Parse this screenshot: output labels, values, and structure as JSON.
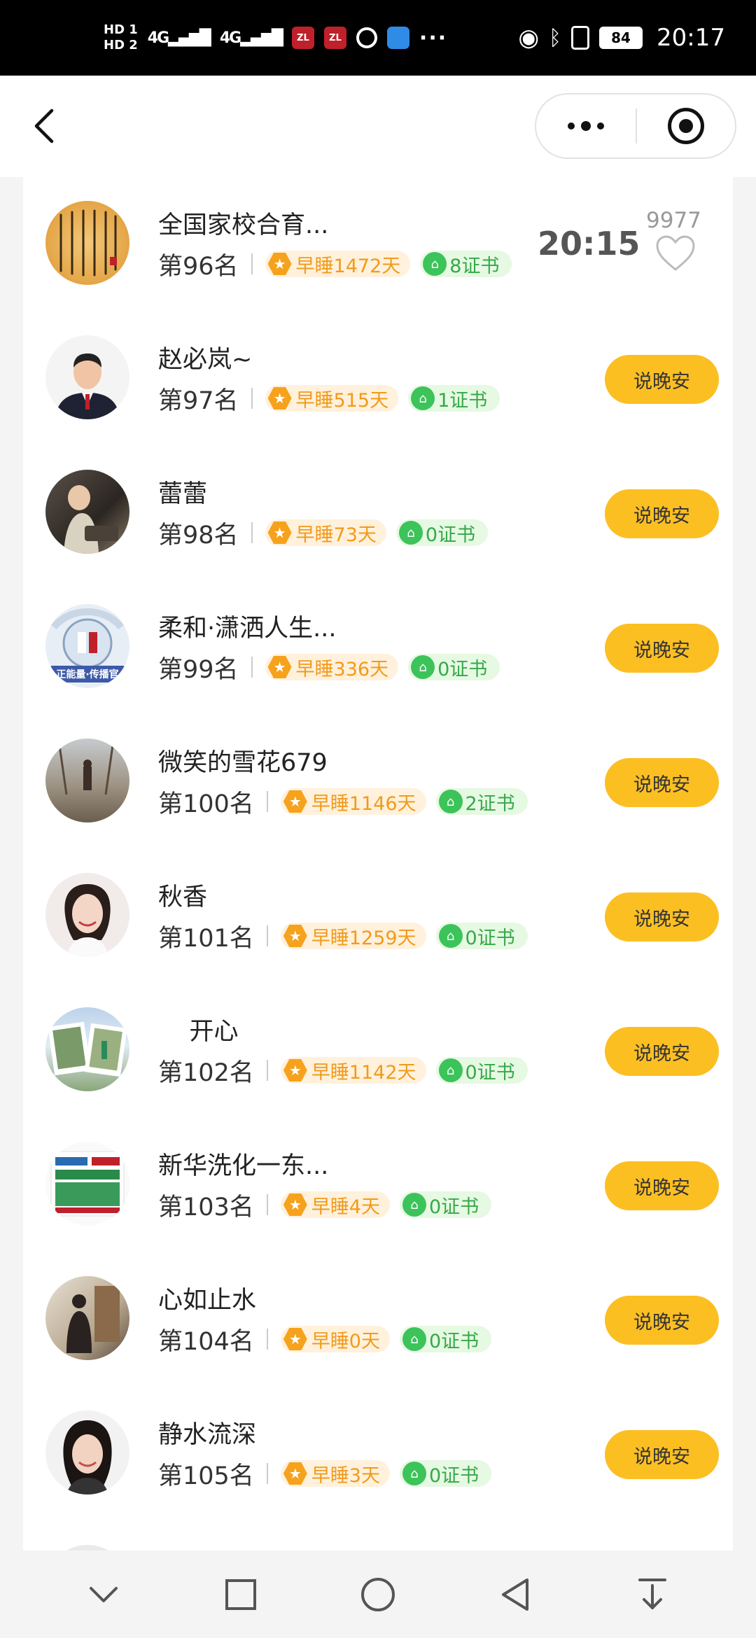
{
  "status_bar": {
    "hd1": "HD 1",
    "hd2": "HD 2",
    "signal1": "4G",
    "signal2": "4G",
    "app1": "ZL",
    "app2": "ZL",
    "more": "···",
    "battery": "84",
    "time": "20:17"
  },
  "nav": {
    "back_icon": "chevron-left-icon",
    "more_icon": "more-dots-icon",
    "close_icon": "target-circle-icon"
  },
  "first_row_extra": {
    "time": "20:15",
    "likes": "9977"
  },
  "rows": [
    {
      "name": "全国家校合育...",
      "rank": "第96名",
      "sleep": "早睡1472天",
      "cert": "8证书",
      "button": ""
    },
    {
      "name": "赵必岚~",
      "rank": "第97名",
      "sleep": "早睡515天",
      "cert": "1证书",
      "button": "说晚安"
    },
    {
      "name": "蕾蕾",
      "rank": "第98名",
      "sleep": "早睡73天",
      "cert": "0证书",
      "button": "说晚安"
    },
    {
      "name": "柔和·潇洒人生...",
      "rank": "第99名",
      "sleep": "早睡336天",
      "cert": "0证书",
      "button": "说晚安"
    },
    {
      "name": "微笑的雪花679",
      "rank": "第100名",
      "sleep": "早睡1146天",
      "cert": "2证书",
      "button": "说晚安"
    },
    {
      "name": "秋香",
      "rank": "第101名",
      "sleep": "早睡1259天",
      "cert": "0证书",
      "button": "说晚安"
    },
    {
      "name": "    开心",
      "rank": "第102名",
      "sleep": "早睡1142天",
      "cert": "0证书",
      "button": "说晚安"
    },
    {
      "name": "新华洗化一东...",
      "rank": "第103名",
      "sleep": "早睡4天",
      "cert": "0证书",
      "button": "说晚安"
    },
    {
      "name": "心如止水",
      "rank": "第104名",
      "sleep": "早睡0天",
      "cert": "0证书",
      "button": "说晚安"
    },
    {
      "name": "静水流深",
      "rank": "第105名",
      "sleep": "早睡3天",
      "cert": "0证书",
      "button": "说晚安"
    }
  ],
  "avatar_badge": "正能量·传播官",
  "colors": {
    "button": "#fcbf22",
    "sleep_text": "#f29a1a",
    "cert_text": "#36a84a"
  },
  "sys_nav": [
    "collapse-icon",
    "recent-apps-icon",
    "home-icon",
    "back-icon",
    "notification-pull-icon"
  ]
}
